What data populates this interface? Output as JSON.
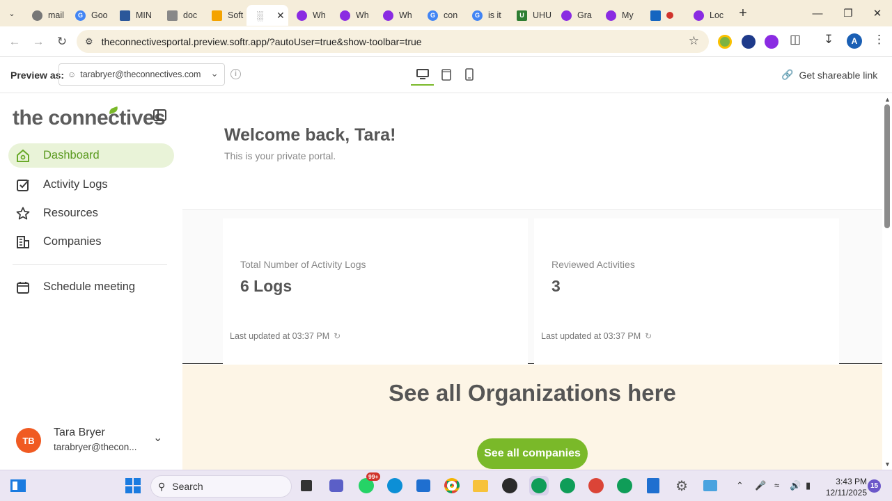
{
  "browser": {
    "tabs": [
      {
        "label": "mail",
        "color": "#777777"
      },
      {
        "label": "Goo",
        "color": "#4285f4"
      },
      {
        "label": "MIN",
        "color": "#2b579a"
      },
      {
        "label": "doc",
        "color": "#888888"
      },
      {
        "label": "Soft",
        "color": "#f4a300"
      },
      {
        "label": "",
        "color": "#555555"
      },
      {
        "label": "Wh",
        "color": "#8a2be2"
      },
      {
        "label": "Wh",
        "color": "#8a2be2"
      },
      {
        "label": "Wh",
        "color": "#8a2be2"
      },
      {
        "label": "con",
        "color": "#4285f4"
      },
      {
        "label": "is it",
        "color": "#4285f4"
      },
      {
        "label": "UHU",
        "color": "#2e7d32"
      },
      {
        "label": "Gra",
        "color": "#8a2be2"
      },
      {
        "label": "My",
        "color": "#8a2be2"
      },
      {
        "label": "",
        "color": "#1565c0"
      },
      {
        "label": "Loc",
        "color": "#8a2be2"
      }
    ],
    "url": "theconnectivesportal.preview.softr.app/?autoUser=true&show-toolbar=true"
  },
  "preview": {
    "label": "Preview as:",
    "user": "tarabryer@theconnectives.com",
    "share": "Get shareable link"
  },
  "sidebar": {
    "logo": "the connectives",
    "items": [
      {
        "label": "Dashboard"
      },
      {
        "label": "Activity Logs"
      },
      {
        "label": "Resources"
      },
      {
        "label": "Companies"
      },
      {
        "label": "Schedule meeting"
      }
    ],
    "user": {
      "initials": "TB",
      "name": "Tara Bryer",
      "email": "tarabryer@thecon..."
    }
  },
  "main": {
    "welcome": "Welcome back, Tara!",
    "subtitle": "This is your private portal.",
    "stats": [
      {
        "label": "Total Number of Activity Logs",
        "value": "6 Logs",
        "updated": "Last updated at 03:37 PM"
      },
      {
        "label": "Reviewed Activities",
        "value": "3",
        "updated": "Last updated at 03:37 PM"
      }
    ],
    "orgs_title": "See all Organizations here",
    "orgs_button": "See all companies"
  },
  "taskbar": {
    "search": "Search",
    "whatsapp_badge": "99+",
    "time": "3:43 PM",
    "date": "12/11/2025",
    "notifications": "15"
  }
}
